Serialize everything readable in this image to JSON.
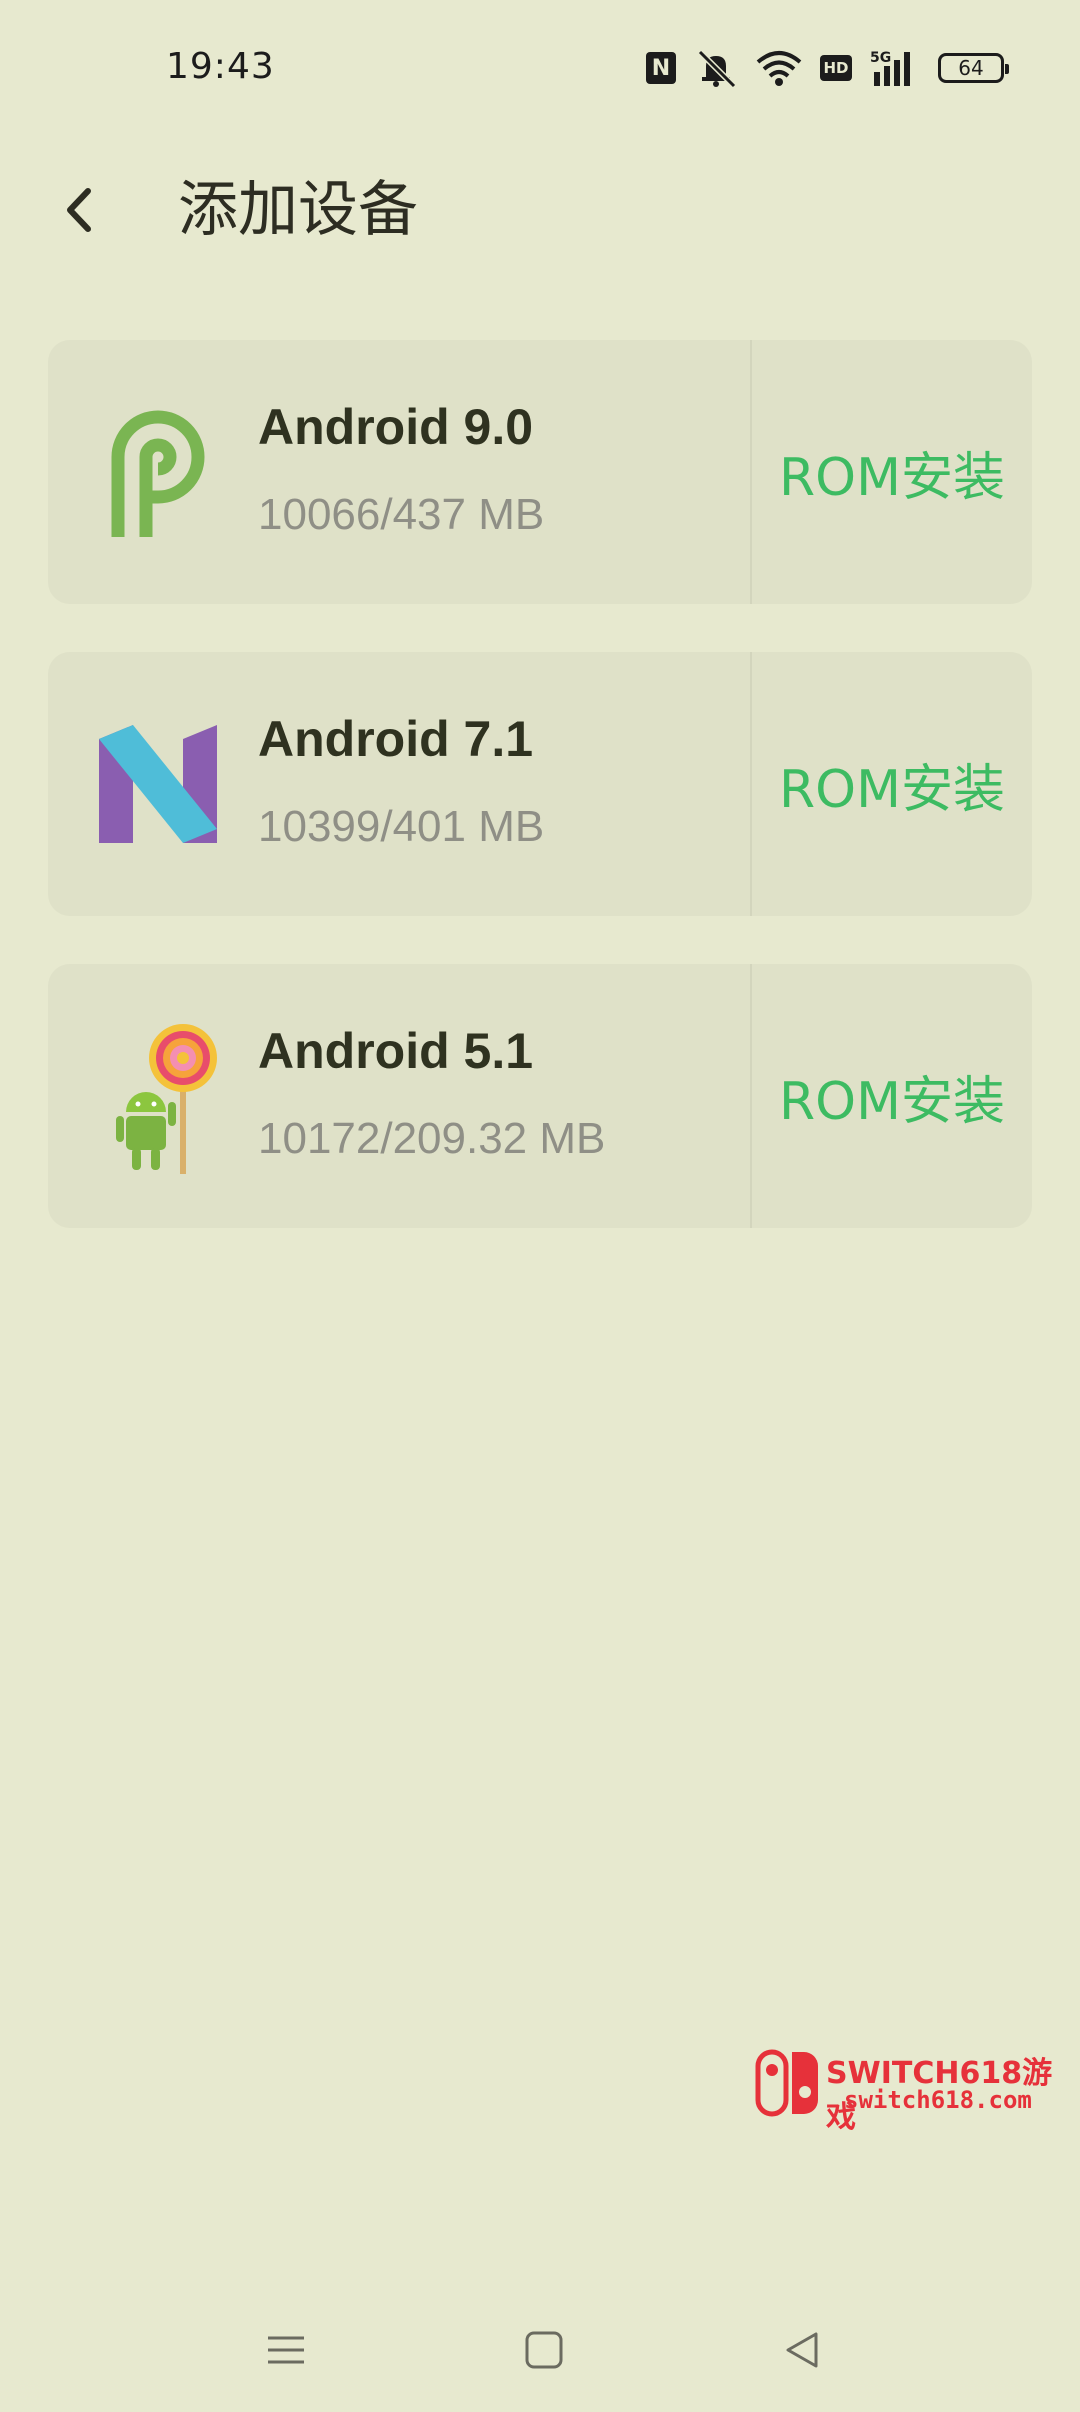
{
  "status_bar": {
    "time": "19:43",
    "icons": [
      "nfc-icon",
      "mute-icon",
      "wifi-icon",
      "hd-icon",
      "signal-5g-icon",
      "battery-icon"
    ],
    "nfc_label": "N",
    "hd_label": "HD",
    "network_label": "5G",
    "battery_level": "64"
  },
  "header": {
    "back_icon": "chevron-left-icon",
    "title": "添加设备"
  },
  "devices": [
    {
      "name": "Android 9.0",
      "size": "10066/437 MB",
      "action": "ROM安装",
      "logo": "android-pie-logo"
    },
    {
      "name": "Android 7.1",
      "size": "10399/401 MB",
      "action": "ROM安装",
      "logo": "android-nougat-logo"
    },
    {
      "name": "Android 5.1",
      "size": "10172/209.32 MB",
      "action": "ROM安装",
      "logo": "android-lollipop-logo"
    }
  ],
  "watermark": {
    "title": "SWITCH618游戏",
    "url": "switch618.com"
  },
  "nav_bar": {
    "icons": [
      "menu-icon",
      "home-icon",
      "back-icon"
    ]
  },
  "colors": {
    "background": "#e7e9cf",
    "card": "#dfe1c8",
    "accent": "#3dbb62",
    "watermark": "#e6313a"
  }
}
